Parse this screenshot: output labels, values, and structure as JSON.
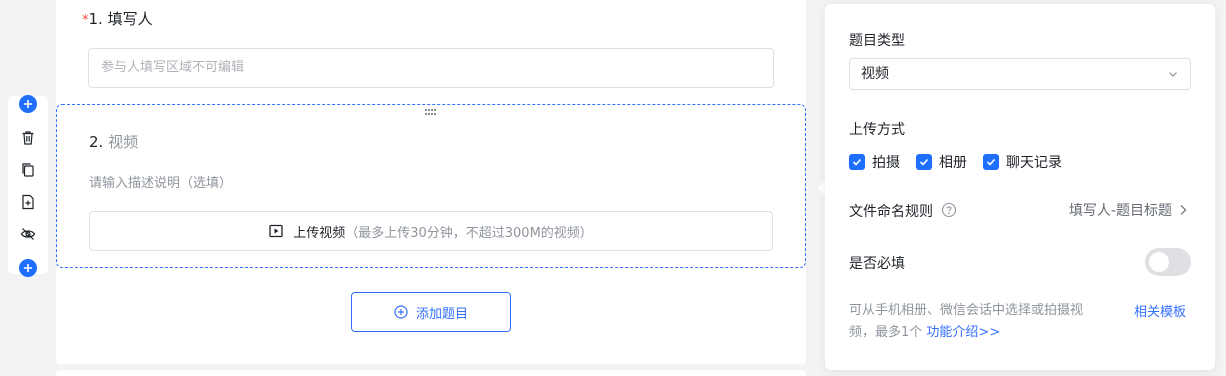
{
  "form": {
    "q1": {
      "required_mark": "*",
      "title": "1. 填写人",
      "placeholder": "参与人填写区域不可编辑"
    },
    "q2": {
      "number": "2.",
      "name": "视频",
      "desc_placeholder": "请输入描述说明（选填）",
      "upload_label": "上传视频",
      "upload_hint": "（最多上传30分钟，不超过300M的视频）"
    },
    "add_question": "添加题目"
  },
  "toolbar": {
    "icons": [
      "add-above-icon",
      "trash-icon",
      "copy-icon",
      "file-add-icon",
      "eye-off-icon",
      "add-below-icon"
    ]
  },
  "panel": {
    "type_label": "题目类型",
    "type_value": "视频",
    "upload_method_label": "上传方式",
    "upload_methods": [
      {
        "label": "拍摄",
        "checked": true
      },
      {
        "label": "相册",
        "checked": true
      },
      {
        "label": "聊天记录",
        "checked": true
      }
    ],
    "naming_label": "文件命名规则",
    "naming_value": "填写人-题目标题",
    "required_label": "是否必填",
    "required_on": false,
    "tip_text": "可从手机相册、微信会话中选择或拍摄视频，最多1个",
    "tip_link": "功能介绍>>",
    "template_link": "相关模板"
  },
  "colors": {
    "accent": "#3370ff",
    "required": "#f54a45",
    "muted": "#8f959e"
  }
}
